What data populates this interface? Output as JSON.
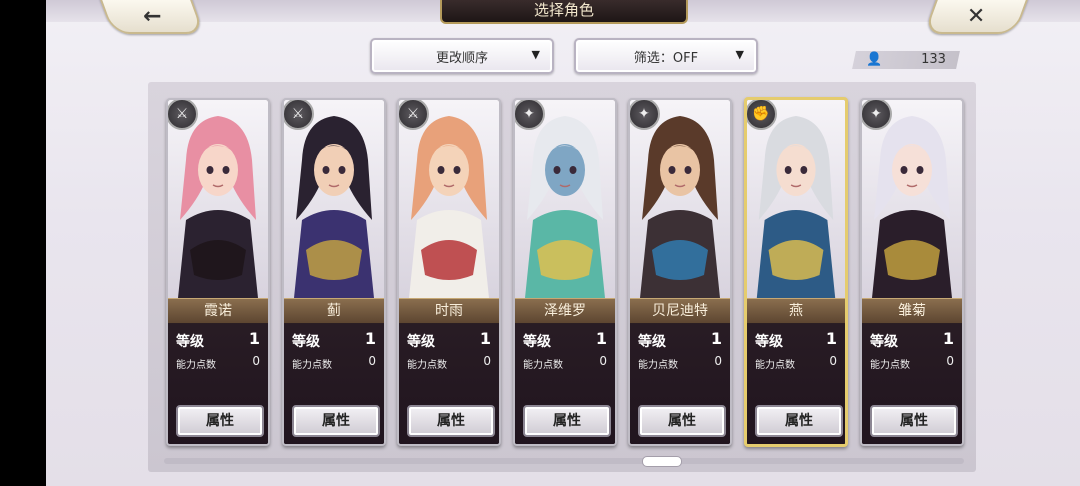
{
  "header": {
    "title": "选择角色",
    "back_icon": "←",
    "close_icon": "✕"
  },
  "controls": {
    "sort_label": "更改顺序",
    "filter_label": "筛选：OFF",
    "caret": "▼",
    "user_icon": "👤",
    "count": "133"
  },
  "labels": {
    "level": "等级",
    "ability_points": "能力点数",
    "attribute": "属性"
  },
  "characters": [
    {
      "name": "霞诺",
      "level": "1",
      "points": "0",
      "class_icon": "⚔",
      "selected": false,
      "palette": {
        "hair": "#e88fa3",
        "skin": "#f7d6c9",
        "outfit": "#2b2230",
        "accent": "#1d1418"
      }
    },
    {
      "name": "蓟",
      "level": "1",
      "points": "0",
      "class_icon": "⚔",
      "selected": false,
      "palette": {
        "hair": "#2a2230",
        "skin": "#f1cfb6",
        "outfit": "#3b3270",
        "accent": "#c9a640"
      }
    },
    {
      "name": "时雨",
      "level": "1",
      "points": "0",
      "class_icon": "⚔",
      "selected": false,
      "palette": {
        "hair": "#e8a17a",
        "skin": "#f4d3b9",
        "outfit": "#f1eee9",
        "accent": "#b3282c"
      }
    },
    {
      "name": "泽维罗",
      "level": "1",
      "points": "0",
      "class_icon": "✦",
      "selected": false,
      "palette": {
        "hair": "#e7e9ee",
        "skin": "#7fa6c4",
        "outfit": "#5ab7a6",
        "accent": "#e6c14b"
      }
    },
    {
      "name": "贝尼迪特",
      "level": "1",
      "points": "0",
      "class_icon": "✦",
      "selected": false,
      "palette": {
        "hair": "#5a3a2a",
        "skin": "#e9c4a4",
        "outfit": "#3c3035",
        "accent": "#2f7fb6"
      }
    },
    {
      "name": "燕",
      "level": "1",
      "points": "0",
      "class_icon": "✊",
      "selected": true,
      "palette": {
        "hair": "#d9dbe0",
        "skin": "#f5ddd0",
        "outfit": "#2d5b86",
        "accent": "#e4c04b"
      }
    },
    {
      "name": "雏菊",
      "level": "1",
      "points": "0",
      "class_icon": "✦",
      "selected": false,
      "palette": {
        "hair": "#e5e2ee",
        "skin": "#f6e0d8",
        "outfit": "#2a1e2a",
        "accent": "#c9a640"
      }
    }
  ]
}
